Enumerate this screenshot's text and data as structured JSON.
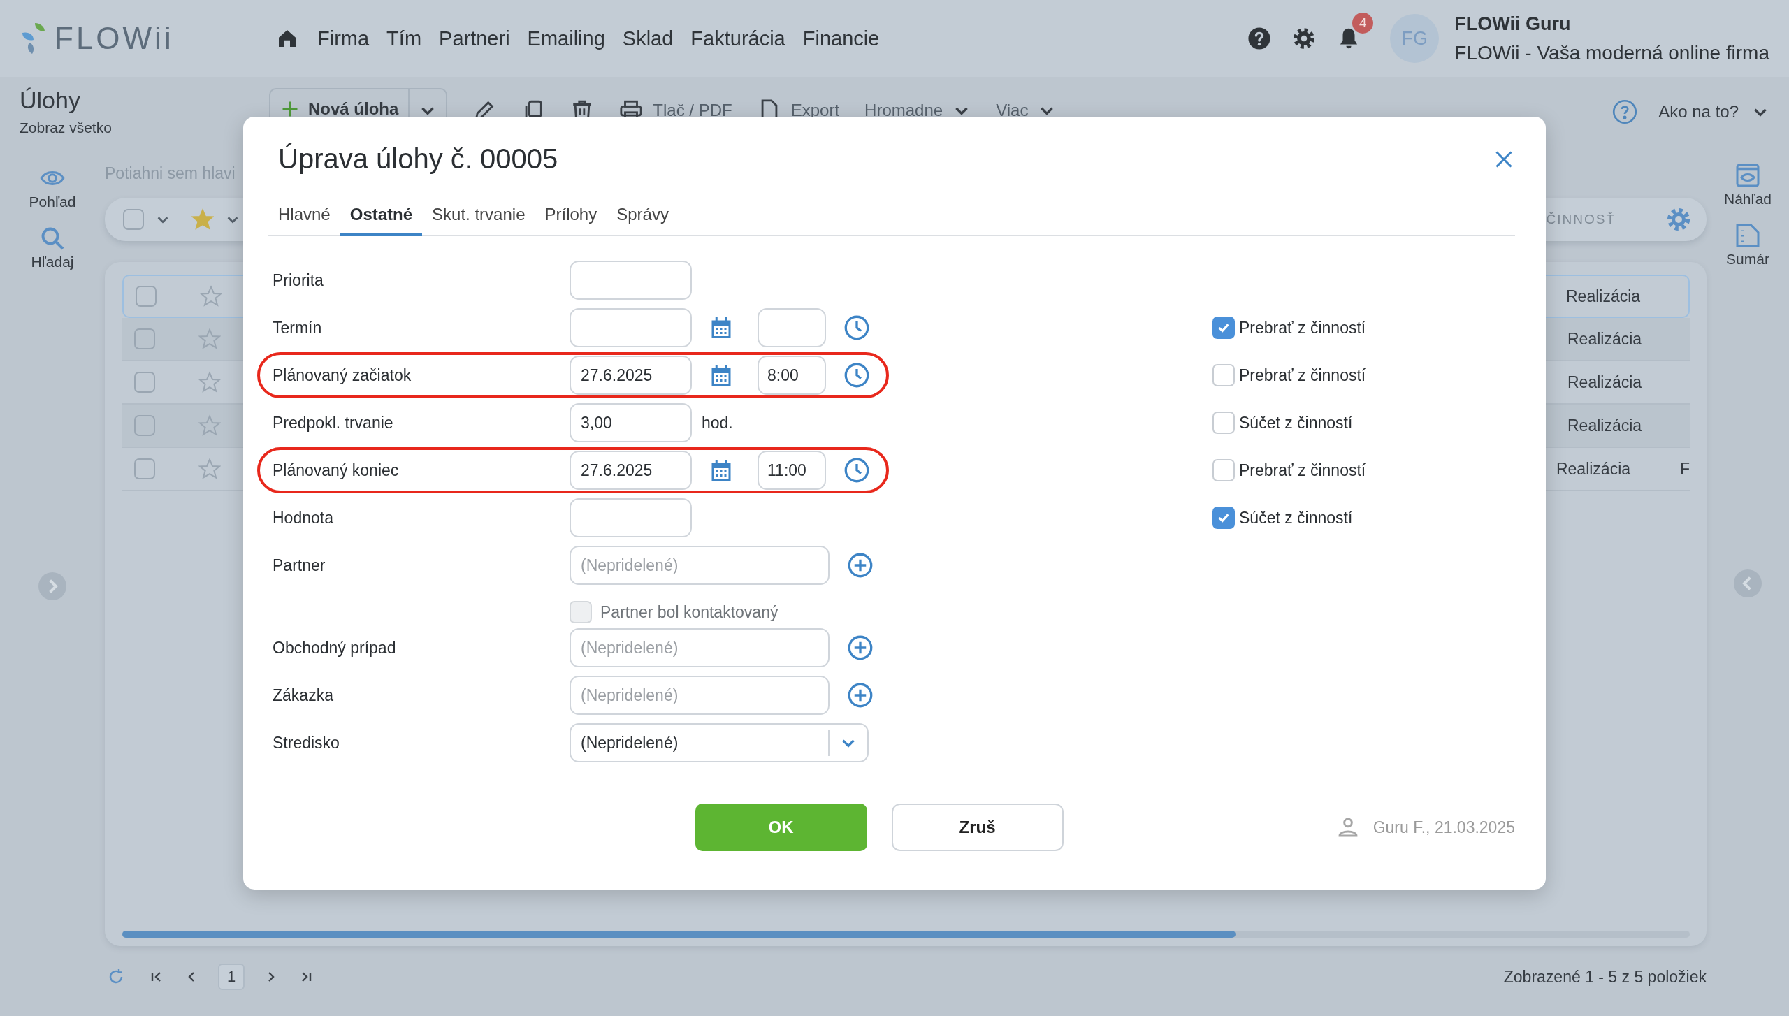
{
  "app": {
    "logo": "FLOWii",
    "nav": [
      "Firma",
      "Tím",
      "Partneri",
      "Emailing",
      "Sklad",
      "Fakturácia",
      "Financie"
    ],
    "notifications": "4",
    "user": {
      "initials": "FG",
      "name": "FLOWii Guru",
      "company": "FLOWii - Vaša moderná online firma"
    }
  },
  "page": {
    "title": "Úlohy",
    "subtitle": "Zobraz všetko"
  },
  "toolbar": {
    "new_button": "Nová úloha",
    "print": "Tlač / PDF",
    "export": "Export",
    "bulk": "Hromadne",
    "more": "Viac",
    "help": "Ako na to?"
  },
  "left_rail": [
    {
      "kind": "view",
      "label": "Pohľad"
    },
    {
      "kind": "search",
      "label": "Hľadaj"
    }
  ],
  "right_rail": [
    {
      "kind": "preview",
      "label": "Náhľad"
    },
    {
      "kind": "summary",
      "label": "Sumár"
    }
  ],
  "grid": {
    "group_hint": "Potiahni sem hlavi",
    "select_all": {
      "checked": false
    },
    "star_filter": {
      "starred": true
    },
    "column_header": "ČINNOSŤ",
    "rows": [
      {
        "selected": true,
        "checked": false,
        "starred": false,
        "activity": "Realizácia"
      },
      {
        "selected": false,
        "checked": false,
        "starred": false,
        "activity": "Realizácia"
      },
      {
        "selected": false,
        "checked": false,
        "starred": false,
        "activity": "Realizácia"
      },
      {
        "selected": false,
        "checked": false,
        "starred": false,
        "activity": "Realizácia"
      },
      {
        "selected": false,
        "checked": false,
        "starred": false,
        "activity": "Realizácia",
        "column_cut": "F"
      }
    ]
  },
  "pager": {
    "page": "1",
    "summary": "Zobrazené 1 - 5 z 5 položiek"
  },
  "dialog": {
    "title": "Úprava úlohy č. 00005",
    "tabs": [
      {
        "label": "Hlavné",
        "selected": false
      },
      {
        "label": "Ostatné",
        "selected": true
      },
      {
        "label": "Skut. trvanie",
        "selected": false
      },
      {
        "label": "Prílohy",
        "selected": false
      },
      {
        "label": "Správy",
        "selected": false
      }
    ],
    "fields": [
      {
        "kind": "text",
        "label": "Priorita",
        "highlighted": false
      },
      {
        "kind": "datetime",
        "label": "Termín",
        "highlighted": false,
        "option": {
          "label": "Prebrať z činností",
          "checked": true
        }
      },
      {
        "kind": "datetime",
        "label": "Plánovaný začiatok",
        "date": "27.6.2025",
        "time": "8:00",
        "highlighted": true,
        "option": {
          "label": "Prebrať z činností",
          "checked": false
        }
      },
      {
        "kind": "duration",
        "label": "Predpokl. trvanie",
        "value": "3,00",
        "unit": "hod.",
        "highlighted": false,
        "option": {
          "label": "Súčet z činností",
          "checked": false
        }
      },
      {
        "kind": "datetime",
        "label": "Plánovaný koniec",
        "date": "27.6.2025",
        "time": "11:00",
        "highlighted": true,
        "option": {
          "label": "Prebrať z činností",
          "checked": false
        }
      },
      {
        "kind": "text",
        "label": "Hodnota",
        "highlighted": false,
        "option": {
          "label": "Súčet z činností",
          "checked": true
        }
      },
      {
        "kind": "lookup",
        "label": "Partner",
        "placeholder": "(Nepridelené)",
        "highlighted": false
      },
      {
        "kind": "flag",
        "label": "Partner bol kontaktovaný",
        "checked": false,
        "disabled": true,
        "highlighted": false
      },
      {
        "kind": "lookup",
        "label": "Obchodný prípad",
        "placeholder": "(Nepridelené)",
        "highlighted": false
      },
      {
        "kind": "lookup",
        "label": "Zákazka",
        "placeholder": "(Nepridelené)",
        "highlighted": false
      },
      {
        "kind": "select",
        "label": "Stredisko",
        "value": "(Nepridelené)",
        "highlighted": false
      }
    ],
    "ok": "OK",
    "cancel": "Zruš",
    "modified": "Guru F., 21.03.2025"
  }
}
